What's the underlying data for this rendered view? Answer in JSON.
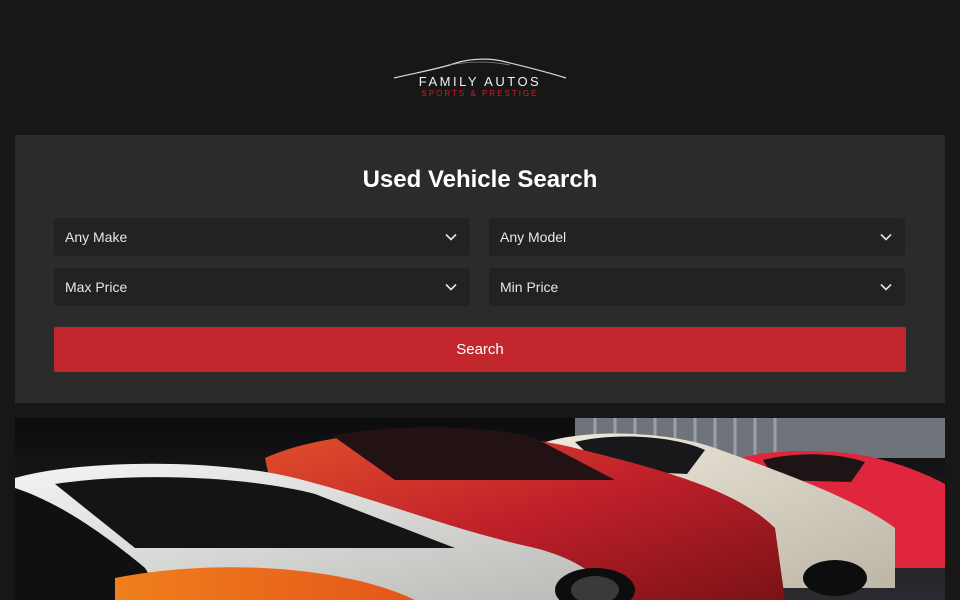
{
  "header": {
    "logo_brand": "FAMILY AUTOS",
    "logo_tagline": "SPORTS & PRESTIGE"
  },
  "search": {
    "title": "Used Vehicle Search",
    "make_label": "Any Make",
    "model_label": "Any Model",
    "max_price_label": "Max Price",
    "min_price_label": "Min Price",
    "button_label": "Search"
  },
  "colors": {
    "background": "#171717",
    "panel": "#2b2b2b",
    "select": "#222222",
    "accent": "#c1272d"
  },
  "icons": {
    "dropdown": "chevron-down-icon"
  }
}
